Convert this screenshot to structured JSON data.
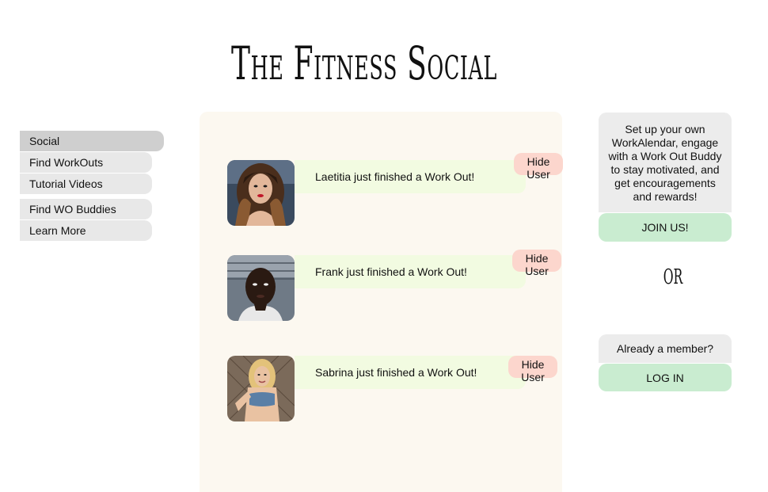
{
  "site": {
    "title": "The Fitness Social"
  },
  "nav": {
    "items": [
      {
        "label": "Social"
      },
      {
        "label": "Find WorkOuts"
      },
      {
        "label": "Tutorial Videos"
      },
      {
        "label": "Find WO Buddies"
      },
      {
        "label": "Learn More"
      }
    ]
  },
  "feed": {
    "items": [
      {
        "message": "Laetitia just finished a Work Out!",
        "hide_label": "Hide User"
      },
      {
        "message": "Frank just finished a Work Out!",
        "hide_label": "Hide User"
      },
      {
        "message": "Sabrina just finished a Work Out!",
        "hide_label": "Hide User"
      }
    ]
  },
  "sidebar_right": {
    "promo_text": "Set up your own WorkAlendar, engage with a Work Out Buddy to stay motivated, and get encouragements and rewards!",
    "join_label": "JOIN US!",
    "or_text": "OR",
    "member_text": "Already a member?",
    "login_label": "LOG IN"
  },
  "colors": {
    "feed_bg": "#fcf8f0",
    "bubble_bg": "#f2fbe1",
    "hide_bg": "#fcd6cd",
    "cta_bg": "#c9ecd0",
    "panel_bg": "#ececec"
  }
}
